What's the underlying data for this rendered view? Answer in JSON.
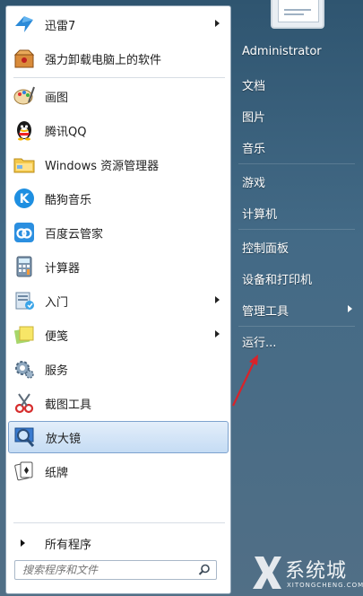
{
  "programs": [
    {
      "label": "迅雷7",
      "icon": "xunlei-bird-icon",
      "has_submenu": true
    },
    {
      "label": "强力卸载电脑上的软件",
      "icon": "uninstall-box-icon",
      "has_submenu": false
    },
    {
      "label": "画图",
      "icon": "paint-palette-icon",
      "has_submenu": false
    },
    {
      "label": "腾讯QQ",
      "icon": "qq-penguin-icon",
      "has_submenu": false
    },
    {
      "label": "Windows 资源管理器",
      "icon": "explorer-folder-icon",
      "has_submenu": false
    },
    {
      "label": "酷狗音乐",
      "icon": "kugou-k-icon",
      "has_submenu": false
    },
    {
      "label": "百度云管家",
      "icon": "baidu-cloud-icon",
      "has_submenu": false
    },
    {
      "label": "计算器",
      "icon": "calculator-icon",
      "has_submenu": false
    },
    {
      "label": "入门",
      "icon": "getting-started-icon",
      "has_submenu": true
    },
    {
      "label": "便笺",
      "icon": "sticky-notes-icon",
      "has_submenu": true
    },
    {
      "label": "服务",
      "icon": "services-gear-icon",
      "has_submenu": false
    },
    {
      "label": "截图工具",
      "icon": "snipping-scissors-icon",
      "has_submenu": false
    },
    {
      "label": "放大镜",
      "icon": "magnifier-icon",
      "has_submenu": false,
      "selected": true
    },
    {
      "label": "纸牌",
      "icon": "solitaire-cards-icon",
      "has_submenu": false
    }
  ],
  "all_programs_label": "所有程序",
  "search": {
    "placeholder": "搜索程序和文件",
    "value": ""
  },
  "right_links": {
    "user": "Administrator",
    "documents": "文档",
    "pictures": "图片",
    "music": "音乐",
    "games": "游戏",
    "computer": "计算机",
    "control_panel": "控制面板",
    "devices_printers": "设备和打印机",
    "admin_tools": "管理工具",
    "run": "运行..."
  },
  "watermark": {
    "brand": "系统城",
    "domain": "XITONGCHENG.COM"
  },
  "colors": {
    "selection": "#c5dcf4",
    "arrow_annotation": "#d9232a",
    "panel_dark": "#436a86"
  }
}
